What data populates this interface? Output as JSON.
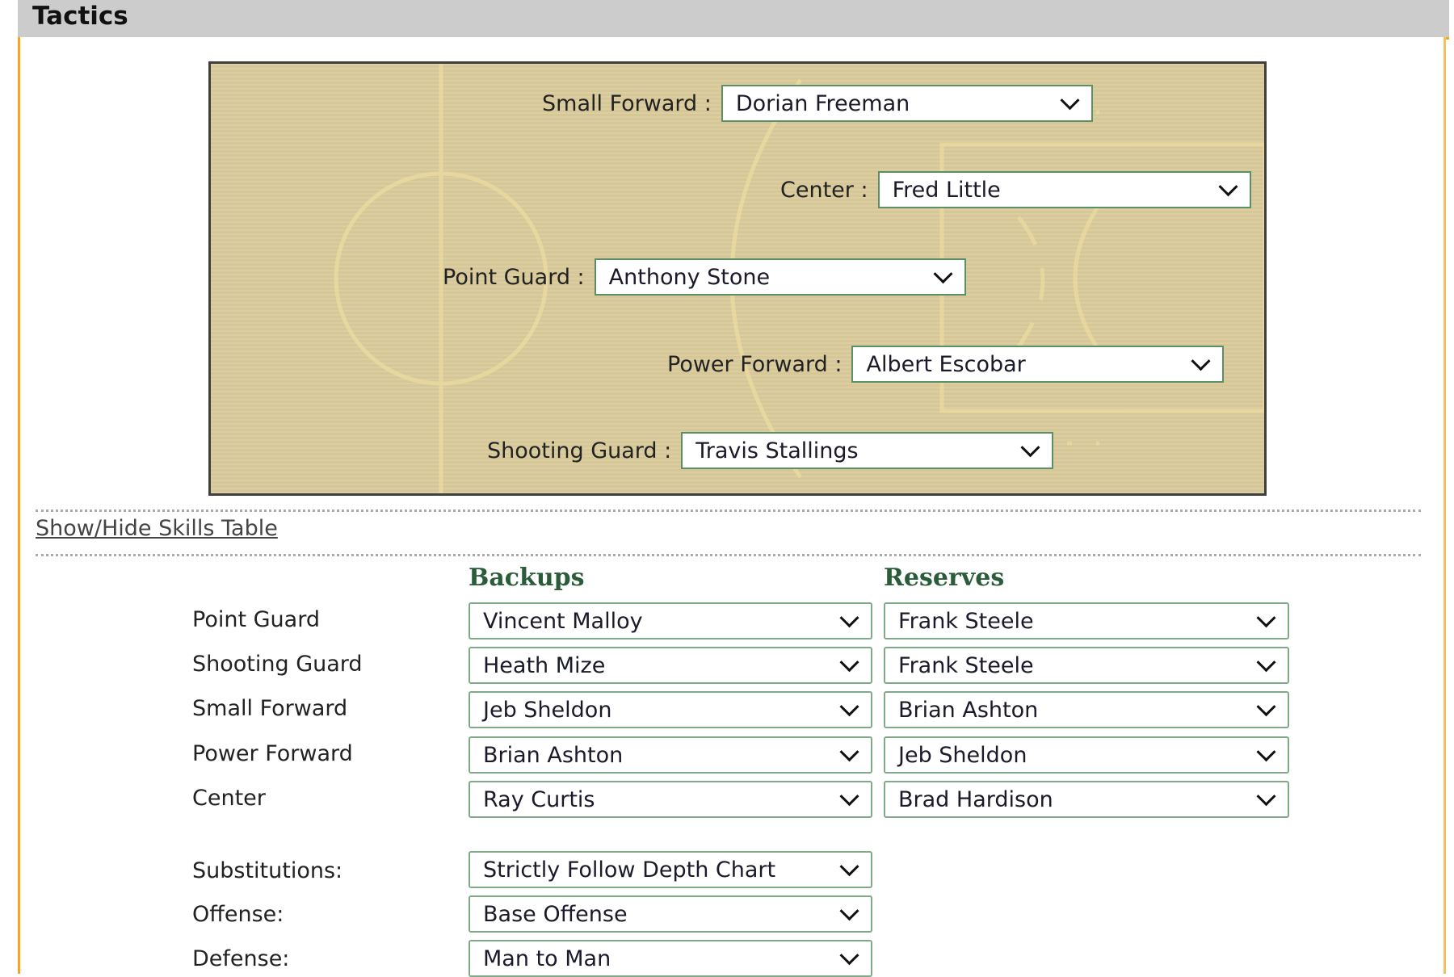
{
  "header": {
    "title": "Tactics"
  },
  "court": {
    "starters": [
      {
        "position": "Small Forward",
        "label": "Small Forward :",
        "player": "Dorian Freeman"
      },
      {
        "position": "Center",
        "label": "Center :",
        "player": "Fred Little"
      },
      {
        "position": "Point Guard",
        "label": "Point Guard :",
        "player": "Anthony Stone"
      },
      {
        "position": "Power Forward",
        "label": "Power Forward :",
        "player": "Albert Escobar"
      },
      {
        "position": "Shooting Guard",
        "label": "Shooting Guard :",
        "player": "Travis Stallings"
      }
    ]
  },
  "skills_link": "Show/Hide Skills Table",
  "depth": {
    "backups_header": "Backups",
    "reserves_header": "Reserves",
    "rows": [
      {
        "position": "Point Guard",
        "backup": "Vincent Malloy",
        "reserve": "Frank Steele"
      },
      {
        "position": "Shooting Guard",
        "backup": "Heath Mize",
        "reserve": "Frank Steele"
      },
      {
        "position": "Small Forward",
        "backup": "Jeb Sheldon",
        "reserve": "Brian Ashton"
      },
      {
        "position": "Power Forward",
        "backup": "Brian Ashton",
        "reserve": "Jeb Sheldon"
      },
      {
        "position": "Center",
        "backup": "Ray Curtis",
        "reserve": "Brad Hardison"
      }
    ]
  },
  "settings": [
    {
      "label": "Substitutions:",
      "value": "Strictly Follow Depth Chart"
    },
    {
      "label": "Offense:",
      "value": "Base Offense"
    },
    {
      "label": "Defense:",
      "value": "Man to Man"
    }
  ],
  "colors": {
    "accent_border": "#f5a623",
    "court": "#dacb9c",
    "select_border": "#5b8f65",
    "heading_green": "#2a5c3a"
  }
}
